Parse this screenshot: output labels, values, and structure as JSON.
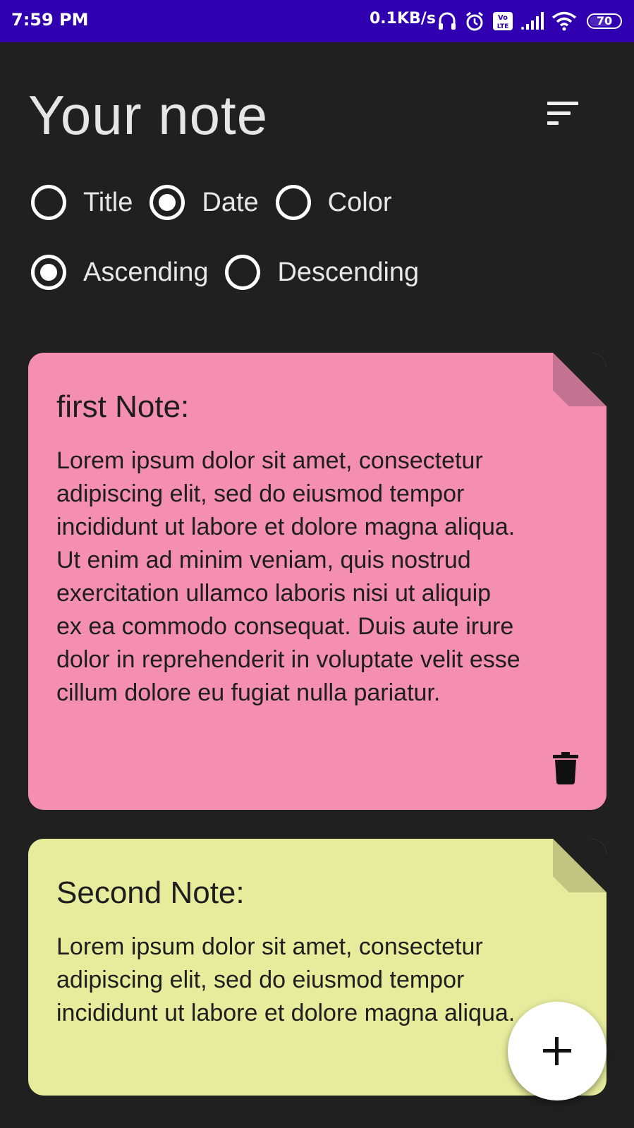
{
  "status_bar": {
    "time": "7:59 PM",
    "network_speed": "0.1KB/s",
    "battery": "70",
    "icons": [
      "headset-icon",
      "alarm-icon",
      "volte-icon",
      "signal-icon",
      "wifi-icon",
      "battery-icon"
    ]
  },
  "header": {
    "title": "Your note",
    "sort_icon": "sort-icon"
  },
  "sort_by": {
    "options": [
      "Title",
      "Date",
      "Color"
    ],
    "selected": "Date"
  },
  "order": {
    "options": [
      "Ascending",
      "Descending"
    ],
    "selected": "Ascending"
  },
  "notes": [
    {
      "title": "first Note:",
      "body": "Lorem ipsum dolor sit amet, consectetur adipiscing elit, sed do eiusmod tempor incididunt ut labore et dolore magna aliqua. Ut enim ad minim veniam, quis nostrud exercitation ullamco laboris nisi ut aliquip ex ea commodo consequat. Duis aute irure dolor in reprehenderit in voluptate velit esse cillum dolore eu fugiat nulla pariatur.",
      "color": "#f48fb1",
      "fold_color": "#c37290"
    },
    {
      "title": "Second Note:",
      "body": "Lorem ipsum dolor sit amet, consectetur adipiscing elit, sed do eiusmod tempor incididunt ut labore et dolore magna aliqua.",
      "color": "#e6ec9c",
      "fold_color": "#c0c57f"
    }
  ],
  "fab": {
    "icon": "plus-icon"
  }
}
